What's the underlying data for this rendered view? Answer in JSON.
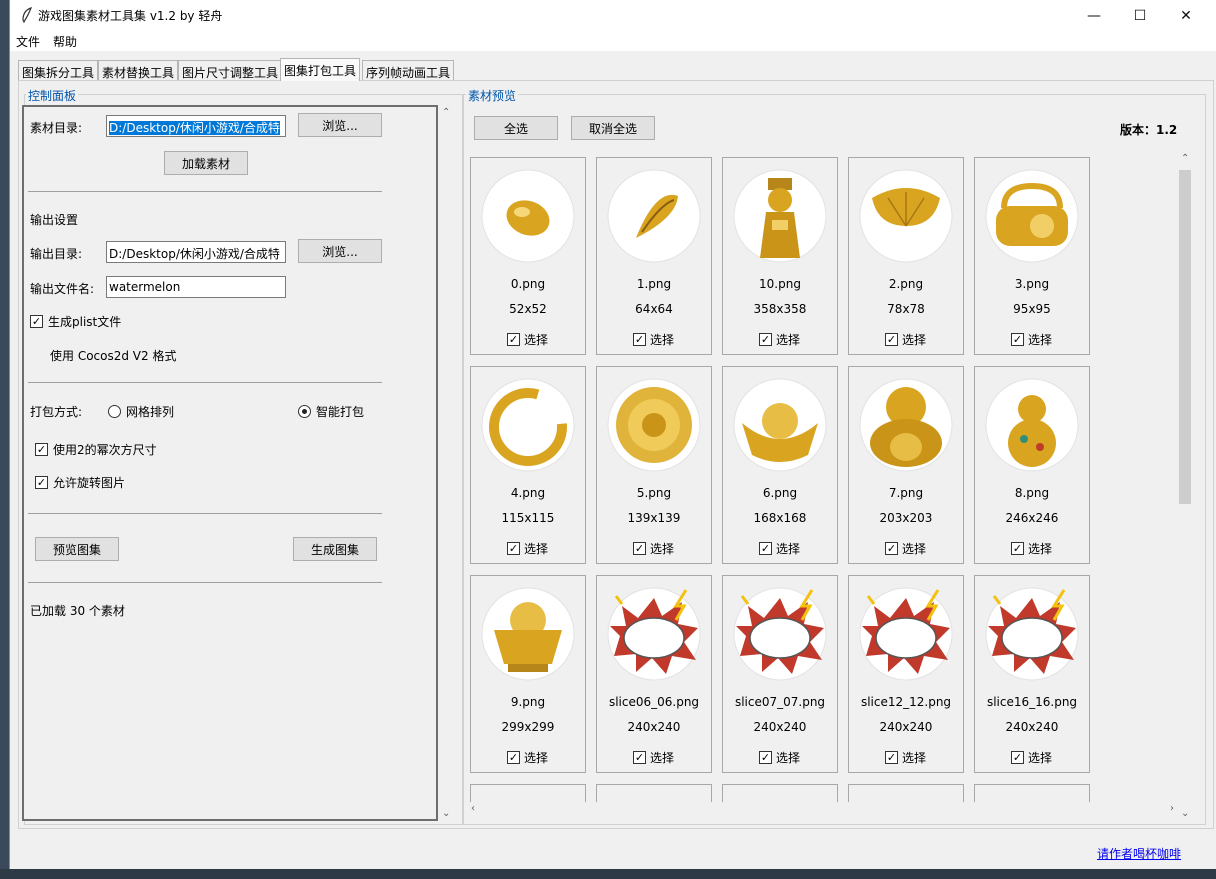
{
  "window": {
    "title": "游戏图集素材工具集 v1.2 by 轻舟",
    "controls": {
      "minimize": "—",
      "maximize": "☐",
      "close": "✕"
    }
  },
  "menu": [
    "文件",
    "帮助"
  ],
  "tabs": [
    {
      "label": "图集拆分工具",
      "active": false
    },
    {
      "label": "素材替换工具",
      "active": false
    },
    {
      "label": "图片尺寸调整工具",
      "active": false
    },
    {
      "label": "图集打包工具",
      "active": true
    },
    {
      "label": "序列帧动画工具",
      "active": false
    }
  ],
  "control_panel": {
    "group_label": "控制面板",
    "source_label": "素材目录:",
    "source_value": "D:/Desktop/休闲小游戏/合成特",
    "browse_label": "浏览...",
    "load_button": "加载素材",
    "output_settings_label": "输出设置",
    "output_dir_label": "输出目录:",
    "output_dir_value": "D:/Desktop/休闲小游戏/合成特",
    "output_browse_label": "浏览...",
    "output_name_label": "输出文件名:",
    "output_name_value": "watermelon",
    "plist_checkbox_label": "生成plist文件",
    "plist_checked": true,
    "format_note": "使用 Cocos2d V2 格式",
    "pack_mode_label": "打包方式:",
    "mode_grid_label": "网格排列",
    "mode_smart_label": "智能打包",
    "selected_mode": "智能打包",
    "pow2_label": "使用2的幂次方尺寸",
    "pow2_checked": true,
    "rotate_label": "允许旋转图片",
    "rotate_checked": true,
    "preview_button": "预览图集",
    "generate_button": "生成图集",
    "status": "已加载 30 个素材"
  },
  "preview": {
    "group_label": "素材预览",
    "select_all": "全选",
    "deselect_all": "取消全选",
    "version_text": "版本：1.2",
    "select_label": "选择",
    "check_mark": "✓",
    "items": [
      {
        "name": "0.png",
        "size": "52x52",
        "icon": "gold-bean-icon",
        "checked": true
      },
      {
        "name": "1.png",
        "size": "64x64",
        "icon": "gold-seed-icon",
        "checked": true
      },
      {
        "name": "10.png",
        "size": "358x358",
        "icon": "gold-deity-icon",
        "checked": true
      },
      {
        "name": "2.png",
        "size": "78x78",
        "icon": "gold-ginkgo-leaf-icon",
        "checked": true
      },
      {
        "name": "3.png",
        "size": "95x95",
        "icon": "gold-lock-icon",
        "checked": true
      },
      {
        "name": "4.png",
        "size": "115x115",
        "icon": "gold-bracelet-icon",
        "checked": true
      },
      {
        "name": "5.png",
        "size": "139x139",
        "icon": "gold-flower-icon",
        "checked": true
      },
      {
        "name": "6.png",
        "size": "168x168",
        "icon": "gold-ingot-icon",
        "checked": true
      },
      {
        "name": "7.png",
        "size": "203x203",
        "icon": "gold-buddha-icon",
        "checked": true
      },
      {
        "name": "8.png",
        "size": "246x246",
        "icon": "gold-gourd-icon",
        "checked": true
      },
      {
        "name": "9.png",
        "size": "299x299",
        "icon": "gold-treasure-bowl-icon",
        "checked": true
      },
      {
        "name": "slice06_06.png",
        "size": "240x240",
        "icon": "explosion-cloud-icon",
        "checked": true
      },
      {
        "name": "slice07_07.png",
        "size": "240x240",
        "icon": "explosion-cloud-icon",
        "checked": true
      },
      {
        "name": "slice12_12.png",
        "size": "240x240",
        "icon": "explosion-cloud-icon",
        "checked": true
      },
      {
        "name": "slice16_16.png",
        "size": "240x240",
        "icon": "explosion-cloud-icon",
        "checked": true
      }
    ]
  },
  "footer_link": "请作者喝杯咖啡",
  "colors": {
    "accent": "#0055aa",
    "gold": "#d9a521",
    "selection": "#0078d7",
    "link": "#0000ee"
  }
}
